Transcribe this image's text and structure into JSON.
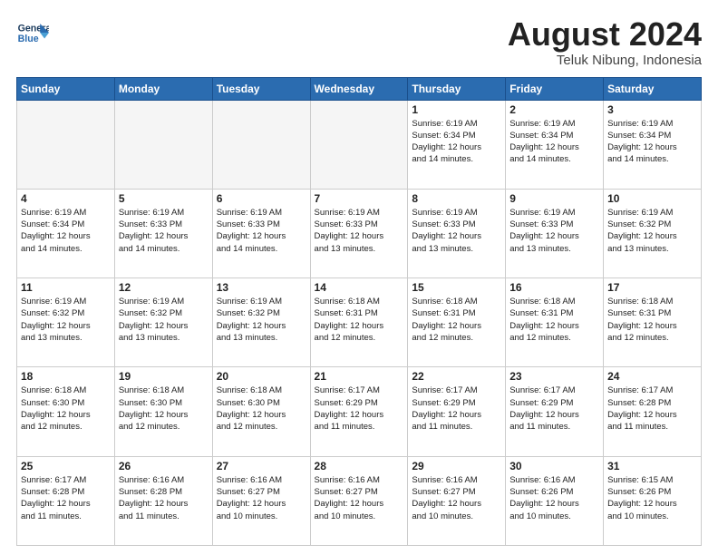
{
  "header": {
    "logo_line1": "General",
    "logo_line2": "Blue",
    "month": "August 2024",
    "location": "Teluk Nibung, Indonesia"
  },
  "weekdays": [
    "Sunday",
    "Monday",
    "Tuesday",
    "Wednesday",
    "Thursday",
    "Friday",
    "Saturday"
  ],
  "weeks": [
    [
      {
        "day": "",
        "info": ""
      },
      {
        "day": "",
        "info": ""
      },
      {
        "day": "",
        "info": ""
      },
      {
        "day": "",
        "info": ""
      },
      {
        "day": "1",
        "info": "Sunrise: 6:19 AM\nSunset: 6:34 PM\nDaylight: 12 hours\nand 14 minutes."
      },
      {
        "day": "2",
        "info": "Sunrise: 6:19 AM\nSunset: 6:34 PM\nDaylight: 12 hours\nand 14 minutes."
      },
      {
        "day": "3",
        "info": "Sunrise: 6:19 AM\nSunset: 6:34 PM\nDaylight: 12 hours\nand 14 minutes."
      }
    ],
    [
      {
        "day": "4",
        "info": "Sunrise: 6:19 AM\nSunset: 6:34 PM\nDaylight: 12 hours\nand 14 minutes."
      },
      {
        "day": "5",
        "info": "Sunrise: 6:19 AM\nSunset: 6:33 PM\nDaylight: 12 hours\nand 14 minutes."
      },
      {
        "day": "6",
        "info": "Sunrise: 6:19 AM\nSunset: 6:33 PM\nDaylight: 12 hours\nand 14 minutes."
      },
      {
        "day": "7",
        "info": "Sunrise: 6:19 AM\nSunset: 6:33 PM\nDaylight: 12 hours\nand 13 minutes."
      },
      {
        "day": "8",
        "info": "Sunrise: 6:19 AM\nSunset: 6:33 PM\nDaylight: 12 hours\nand 13 minutes."
      },
      {
        "day": "9",
        "info": "Sunrise: 6:19 AM\nSunset: 6:33 PM\nDaylight: 12 hours\nand 13 minutes."
      },
      {
        "day": "10",
        "info": "Sunrise: 6:19 AM\nSunset: 6:32 PM\nDaylight: 12 hours\nand 13 minutes."
      }
    ],
    [
      {
        "day": "11",
        "info": "Sunrise: 6:19 AM\nSunset: 6:32 PM\nDaylight: 12 hours\nand 13 minutes."
      },
      {
        "day": "12",
        "info": "Sunrise: 6:19 AM\nSunset: 6:32 PM\nDaylight: 12 hours\nand 13 minutes."
      },
      {
        "day": "13",
        "info": "Sunrise: 6:19 AM\nSunset: 6:32 PM\nDaylight: 12 hours\nand 13 minutes."
      },
      {
        "day": "14",
        "info": "Sunrise: 6:18 AM\nSunset: 6:31 PM\nDaylight: 12 hours\nand 12 minutes."
      },
      {
        "day": "15",
        "info": "Sunrise: 6:18 AM\nSunset: 6:31 PM\nDaylight: 12 hours\nand 12 minutes."
      },
      {
        "day": "16",
        "info": "Sunrise: 6:18 AM\nSunset: 6:31 PM\nDaylight: 12 hours\nand 12 minutes."
      },
      {
        "day": "17",
        "info": "Sunrise: 6:18 AM\nSunset: 6:31 PM\nDaylight: 12 hours\nand 12 minutes."
      }
    ],
    [
      {
        "day": "18",
        "info": "Sunrise: 6:18 AM\nSunset: 6:30 PM\nDaylight: 12 hours\nand 12 minutes."
      },
      {
        "day": "19",
        "info": "Sunrise: 6:18 AM\nSunset: 6:30 PM\nDaylight: 12 hours\nand 12 minutes."
      },
      {
        "day": "20",
        "info": "Sunrise: 6:18 AM\nSunset: 6:30 PM\nDaylight: 12 hours\nand 12 minutes."
      },
      {
        "day": "21",
        "info": "Sunrise: 6:17 AM\nSunset: 6:29 PM\nDaylight: 12 hours\nand 11 minutes."
      },
      {
        "day": "22",
        "info": "Sunrise: 6:17 AM\nSunset: 6:29 PM\nDaylight: 12 hours\nand 11 minutes."
      },
      {
        "day": "23",
        "info": "Sunrise: 6:17 AM\nSunset: 6:29 PM\nDaylight: 12 hours\nand 11 minutes."
      },
      {
        "day": "24",
        "info": "Sunrise: 6:17 AM\nSunset: 6:28 PM\nDaylight: 12 hours\nand 11 minutes."
      }
    ],
    [
      {
        "day": "25",
        "info": "Sunrise: 6:17 AM\nSunset: 6:28 PM\nDaylight: 12 hours\nand 11 minutes."
      },
      {
        "day": "26",
        "info": "Sunrise: 6:16 AM\nSunset: 6:28 PM\nDaylight: 12 hours\nand 11 minutes."
      },
      {
        "day": "27",
        "info": "Sunrise: 6:16 AM\nSunset: 6:27 PM\nDaylight: 12 hours\nand 10 minutes."
      },
      {
        "day": "28",
        "info": "Sunrise: 6:16 AM\nSunset: 6:27 PM\nDaylight: 12 hours\nand 10 minutes."
      },
      {
        "day": "29",
        "info": "Sunrise: 6:16 AM\nSunset: 6:27 PM\nDaylight: 12 hours\nand 10 minutes."
      },
      {
        "day": "30",
        "info": "Sunrise: 6:16 AM\nSunset: 6:26 PM\nDaylight: 12 hours\nand 10 minutes."
      },
      {
        "day": "31",
        "info": "Sunrise: 6:15 AM\nSunset: 6:26 PM\nDaylight: 12 hours\nand 10 minutes."
      }
    ]
  ]
}
